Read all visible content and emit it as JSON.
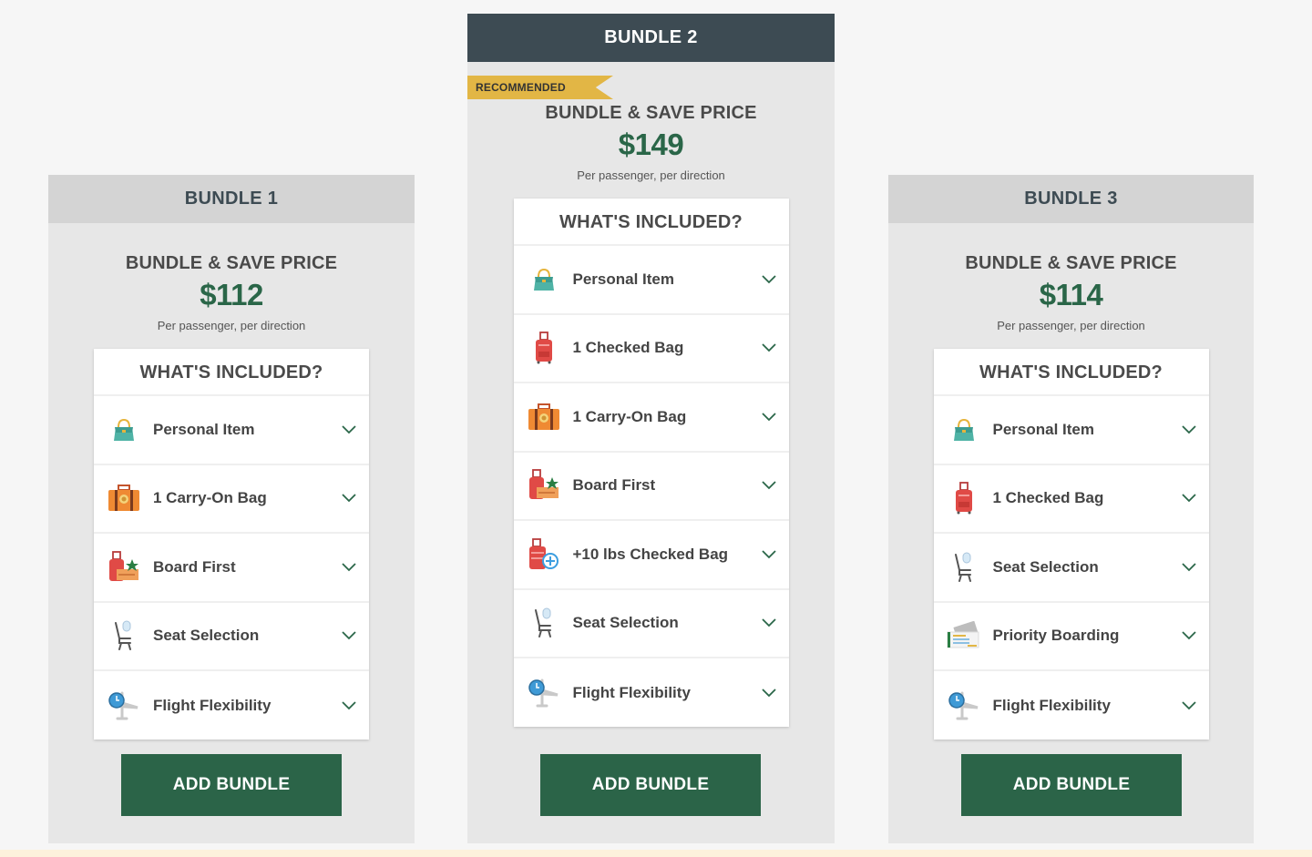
{
  "colors": {
    "accent_green": "#2a6648",
    "button_green": "#2b6448",
    "recommended_header": "#3d4b53",
    "ribbon_gold": "#e2b645",
    "card_bg": "#e7e7e7",
    "header_gray": "#d4d4d4"
  },
  "bundles": [
    {
      "name": "BUNDLE 1",
      "recommended": false,
      "price_title": "BUNDLE & SAVE PRICE",
      "price": "$112",
      "price_note": "Per passenger, per direction",
      "included_title": "WHAT'S INCLUDED?",
      "items": [
        {
          "label": "Personal Item",
          "icon": "handbag-icon"
        },
        {
          "label": "1 Carry-On Bag",
          "icon": "suitcase-icon"
        },
        {
          "label": "Board First",
          "icon": "board-first-icon"
        },
        {
          "label": "Seat Selection",
          "icon": "seat-icon"
        },
        {
          "label": "Flight Flexibility",
          "icon": "plane-clock-icon"
        }
      ],
      "button": "ADD BUNDLE"
    },
    {
      "name": "BUNDLE 2",
      "recommended": true,
      "badge": "RECOMMENDED",
      "price_title": "BUNDLE & SAVE PRICE",
      "price": "$149",
      "price_note": "Per passenger, per direction",
      "included_title": "WHAT'S INCLUDED?",
      "items": [
        {
          "label": "Personal Item",
          "icon": "handbag-icon"
        },
        {
          "label": "1 Checked Bag",
          "icon": "checked-bag-icon"
        },
        {
          "label": "1 Carry-On Bag",
          "icon": "suitcase-icon"
        },
        {
          "label": "Board First",
          "icon": "board-first-icon"
        },
        {
          "label": "+10 lbs Checked Bag",
          "icon": "extra-weight-bag-icon"
        },
        {
          "label": "Seat Selection",
          "icon": "seat-icon"
        },
        {
          "label": "Flight Flexibility",
          "icon": "plane-clock-icon"
        }
      ],
      "button": "ADD BUNDLE"
    },
    {
      "name": "BUNDLE 3",
      "recommended": false,
      "price_title": "BUNDLE & SAVE PRICE",
      "price": "$114",
      "price_note": "Per passenger, per direction",
      "included_title": "WHAT'S INCLUDED?",
      "items": [
        {
          "label": "Personal Item",
          "icon": "handbag-icon"
        },
        {
          "label": "1 Checked Bag",
          "icon": "checked-bag-icon"
        },
        {
          "label": "Seat Selection",
          "icon": "seat-icon"
        },
        {
          "label": "Priority Boarding",
          "icon": "boarding-pass-icon"
        },
        {
          "label": "Flight Flexibility",
          "icon": "plane-clock-icon"
        }
      ],
      "button": "ADD BUNDLE"
    }
  ]
}
